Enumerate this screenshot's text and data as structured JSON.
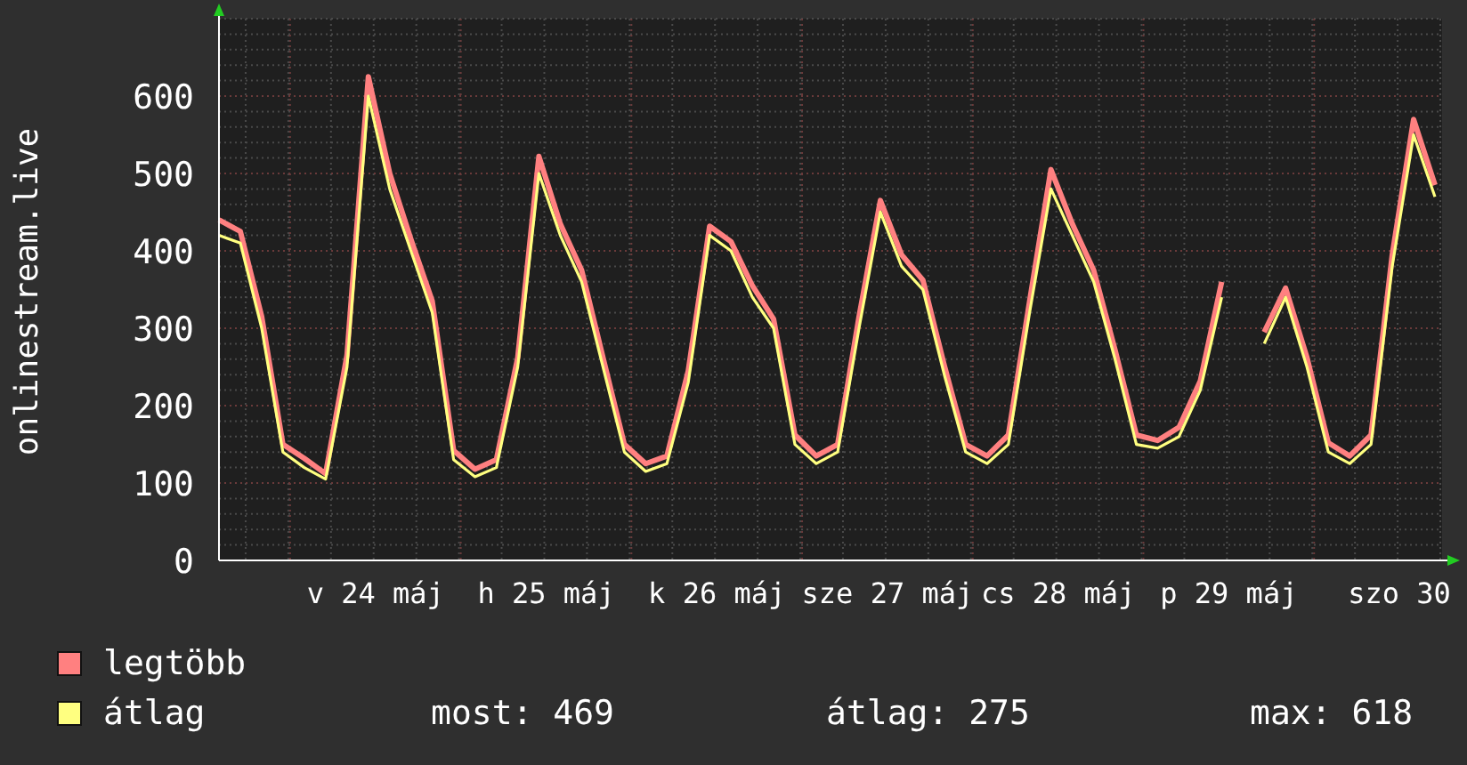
{
  "chart": {
    "chart_data": {
      "type": "line",
      "grid": true,
      "ylabel": "onlinestream.live",
      "ylim": [
        0,
        700
      ],
      "yticks": [
        0,
        100,
        200,
        300,
        400,
        500,
        600
      ],
      "categories": [
        null,
        null,
        null,
        null,
        null,
        null,
        null,
        "v 24 máj",
        null,
        null,
        null,
        null,
        null,
        null,
        null,
        "h 25 máj",
        null,
        null,
        null,
        null,
        null,
        null,
        null,
        "k 26 máj",
        null,
        null,
        null,
        null,
        null,
        null,
        null,
        "sze 27 máj",
        null,
        null,
        null,
        null,
        null,
        null,
        null,
        "cs 28 máj",
        null,
        null,
        null,
        null,
        null,
        null,
        null,
        "p 29 máj",
        null,
        null,
        null,
        null,
        null,
        null,
        null,
        "szo 30",
        null,
        null
      ],
      "series": [
        {
          "name": "legtöbb",
          "color": "#ff8080",
          "values": [
            440,
            425,
            315,
            150,
            132,
            112,
            265,
            625,
            500,
            415,
            335,
            142,
            118,
            130,
            262,
            522,
            435,
            375,
            262,
            150,
            125,
            135,
            245,
            432,
            412,
            355,
            312,
            162,
            135,
            150,
            315,
            465,
            395,
            362,
            252,
            150,
            135,
            162,
            335,
            505,
            435,
            375,
            272,
            162,
            155,
            172,
            232,
            360,
            null,
            295,
            352,
            262,
            152,
            135,
            162,
            395,
            570,
            485
          ]
        },
        {
          "name": "átlag",
          "color": "#ffff80",
          "values": [
            420,
            410,
            300,
            140,
            120,
            105,
            250,
            600,
            480,
            400,
            320,
            130,
            108,
            120,
            250,
            500,
            420,
            360,
            250,
            140,
            115,
            125,
            230,
            420,
            400,
            340,
            300,
            150,
            125,
            140,
            300,
            450,
            380,
            350,
            240,
            140,
            125,
            150,
            320,
            480,
            420,
            360,
            260,
            150,
            145,
            160,
            220,
            340,
            null,
            280,
            340,
            250,
            140,
            125,
            150,
            380,
            550,
            470
          ]
        }
      ]
    }
  },
  "stats": [
    "most: 469",
    "átlag: 275",
    "max: 618"
  ]
}
